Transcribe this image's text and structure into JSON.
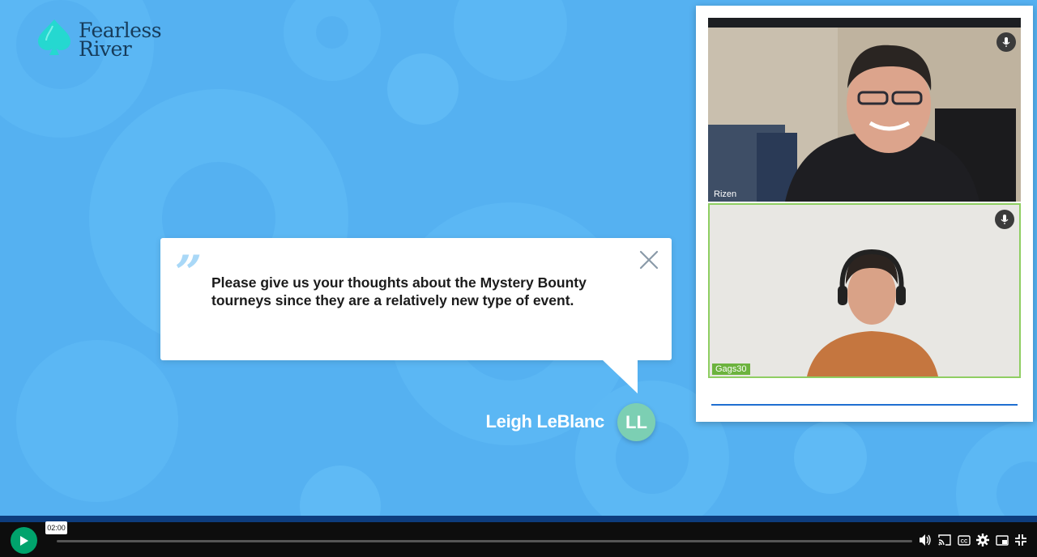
{
  "brand": {
    "line1": "Fearless",
    "line2": "River"
  },
  "quote": {
    "mark": "”",
    "text": "Please give us your thoughts about the Mystery Bounty tourneys since they are a relatively new type of event."
  },
  "author": {
    "name": "Leigh LeBlanc",
    "initials": "LL"
  },
  "participants": [
    {
      "name": "Rizen"
    },
    {
      "name": "Gags30"
    }
  ],
  "player": {
    "time": "02:00",
    "progress": 0.0
  },
  "colors": {
    "background": "#55b1f1",
    "accent": "#00a36c",
    "avatar": "#7ccfb3",
    "active_speaker": "#8fce62"
  },
  "icons": [
    "spade-logo-icon",
    "quote-icon",
    "close-icon",
    "mic-icon",
    "play-icon",
    "volume-icon",
    "cast-icon",
    "captions-icon",
    "settings-icon",
    "pip-icon",
    "fullscreen-exit-icon"
  ]
}
